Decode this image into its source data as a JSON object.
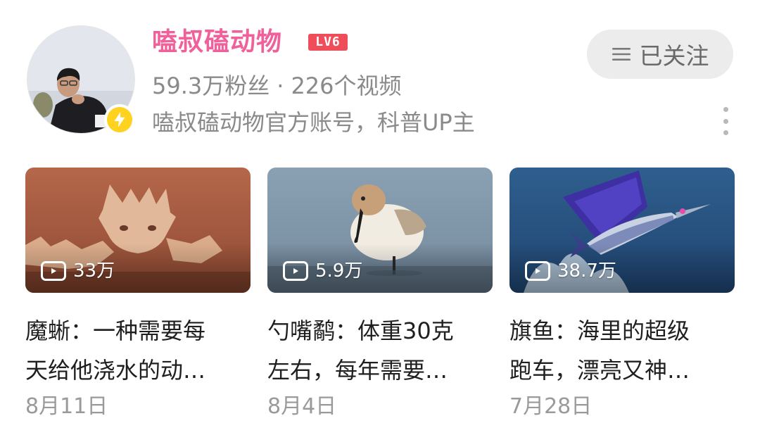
{
  "channel": {
    "name": "嗑叔磕动物",
    "level": "LV6",
    "followers": "59.3万粉丝",
    "separator": "·",
    "videos": "226个视频",
    "description": "嗑叔磕动物官方账号，科普UP主",
    "follow_button_label": "已关注",
    "verified_badge_color": "#ffd21f",
    "name_color": "#f0609a",
    "level_badge_color": "#f04d5b"
  },
  "videos": [
    {
      "views": "33万",
      "title_line1": "魔蜥：一种需要每",
      "title_line2": "天给他浇水的动…",
      "date": "8月11日",
      "thumbnail": "thorny-devil-lizard"
    },
    {
      "views": "5.9万",
      "title_line1": "勺嘴鹬：体重30克",
      "title_line2": "左右，每年需要…",
      "date": "8月4日",
      "thumbnail": "spoon-billed-sandpiper"
    },
    {
      "views": "38.7万",
      "title_line1": "旗鱼：海里的超级",
      "title_line2": "跑车，漂亮又神…",
      "date": "7月28日",
      "thumbnail": "sailfish-leaping"
    }
  ]
}
